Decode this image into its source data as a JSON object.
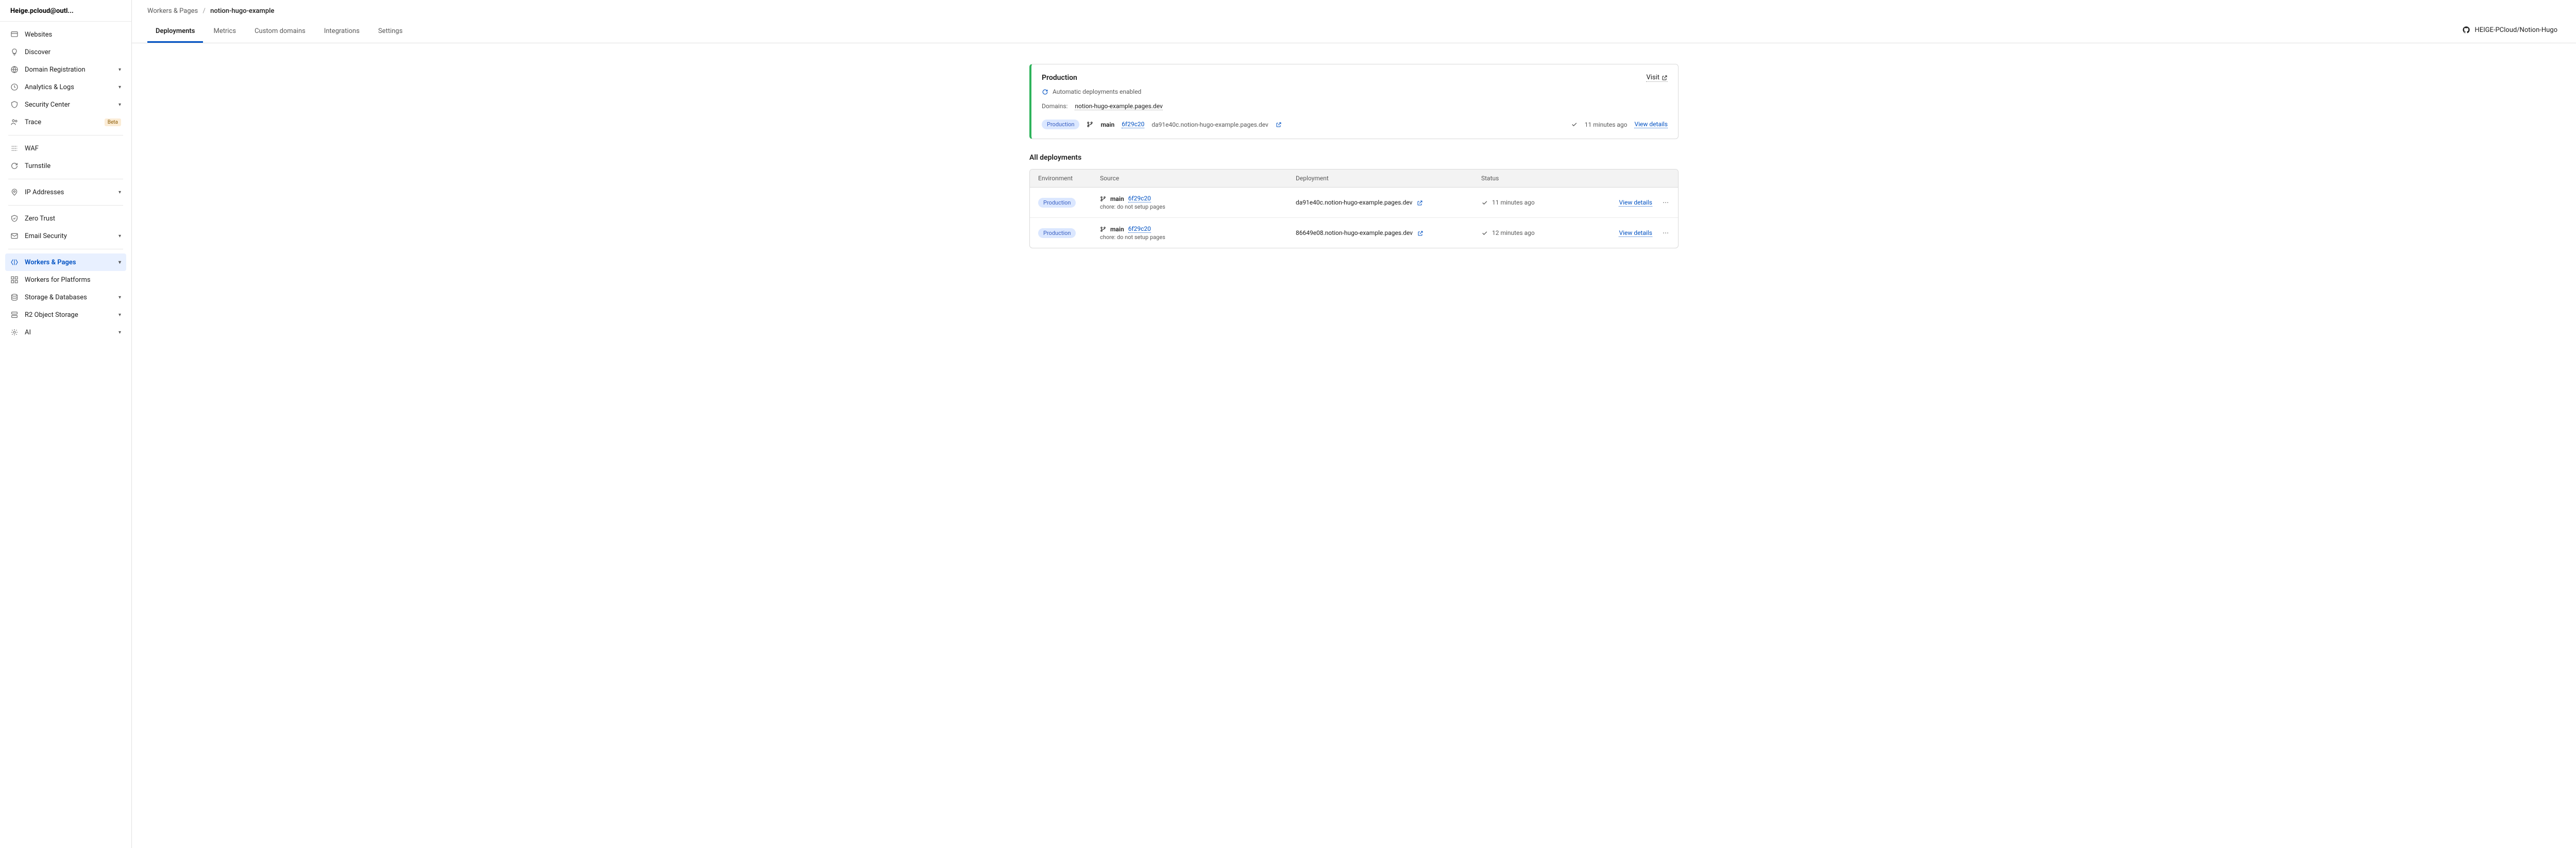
{
  "account": {
    "name": "Heige.pcloud@outl..."
  },
  "sidebar": {
    "items": [
      {
        "label": "Websites",
        "icon": "globe",
        "chevron": false
      },
      {
        "label": "Discover",
        "icon": "bulb",
        "chevron": false
      },
      {
        "label": "Domain Registration",
        "icon": "world",
        "chevron": true
      },
      {
        "label": "Analytics & Logs",
        "icon": "clock",
        "chevron": true
      },
      {
        "label": "Security Center",
        "icon": "shield",
        "chevron": true
      },
      {
        "label": "Trace",
        "icon": "people",
        "chevron": false,
        "badge": "Beta"
      }
    ],
    "items2": [
      {
        "label": "WAF",
        "icon": "waf",
        "chevron": false
      },
      {
        "label": "Turnstile",
        "icon": "refresh",
        "chevron": false
      }
    ],
    "items3": [
      {
        "label": "IP Addresses",
        "icon": "pin",
        "chevron": true
      }
    ],
    "items4": [
      {
        "label": "Zero Trust",
        "icon": "zerotrust",
        "chevron": false
      },
      {
        "label": "Email Security",
        "icon": "mail",
        "chevron": true
      }
    ],
    "items5": [
      {
        "label": "Workers & Pages",
        "icon": "workers",
        "chevron": true,
        "active": true
      },
      {
        "label": "Workers for Platforms",
        "icon": "platforms",
        "chevron": false
      },
      {
        "label": "Storage & Databases",
        "icon": "storage",
        "chevron": true
      },
      {
        "label": "R2 Object Storage",
        "icon": "r2",
        "chevron": true
      },
      {
        "label": "AI",
        "icon": "ai",
        "chevron": true
      }
    ]
  },
  "breadcrumb": {
    "parent": "Workers & Pages",
    "current": "notion-hugo-example"
  },
  "tabs": [
    {
      "label": "Deployments",
      "active": true
    },
    {
      "label": "Metrics",
      "active": false
    },
    {
      "label": "Custom domains",
      "active": false
    },
    {
      "label": "Integrations",
      "active": false
    },
    {
      "label": "Settings",
      "active": false
    }
  ],
  "repo": {
    "label": "HEIGE-PCloud/Notion-Hugo"
  },
  "production": {
    "title": "Production",
    "visit": "Visit",
    "auto": "Automatic deployments enabled",
    "domains_label": "Domains:",
    "domain": "notion-hugo-example.pages.dev",
    "deployment": {
      "env": "Production",
      "branch": "main",
      "commit": "6f29c20",
      "url": "da91e40c.notion-hugo-example.pages.dev",
      "time": "11 minutes ago",
      "view": "View details"
    }
  },
  "all_title": "All deployments",
  "table": {
    "headers": {
      "env": "Environment",
      "src": "Source",
      "dep": "Deployment",
      "status": "Status"
    },
    "rows": [
      {
        "env": "Production",
        "branch": "main",
        "commit": "6f29c20",
        "msg": "chore: do not setup pages",
        "url": "da91e40c.notion-hugo-example.pages.dev",
        "time": "11 minutes ago",
        "view": "View details"
      },
      {
        "env": "Production",
        "branch": "main",
        "commit": "6f29c20",
        "msg": "chore: do not setup pages",
        "url": "86649e08.notion-hugo-example.pages.dev",
        "time": "12 minutes ago",
        "view": "View details"
      }
    ]
  }
}
